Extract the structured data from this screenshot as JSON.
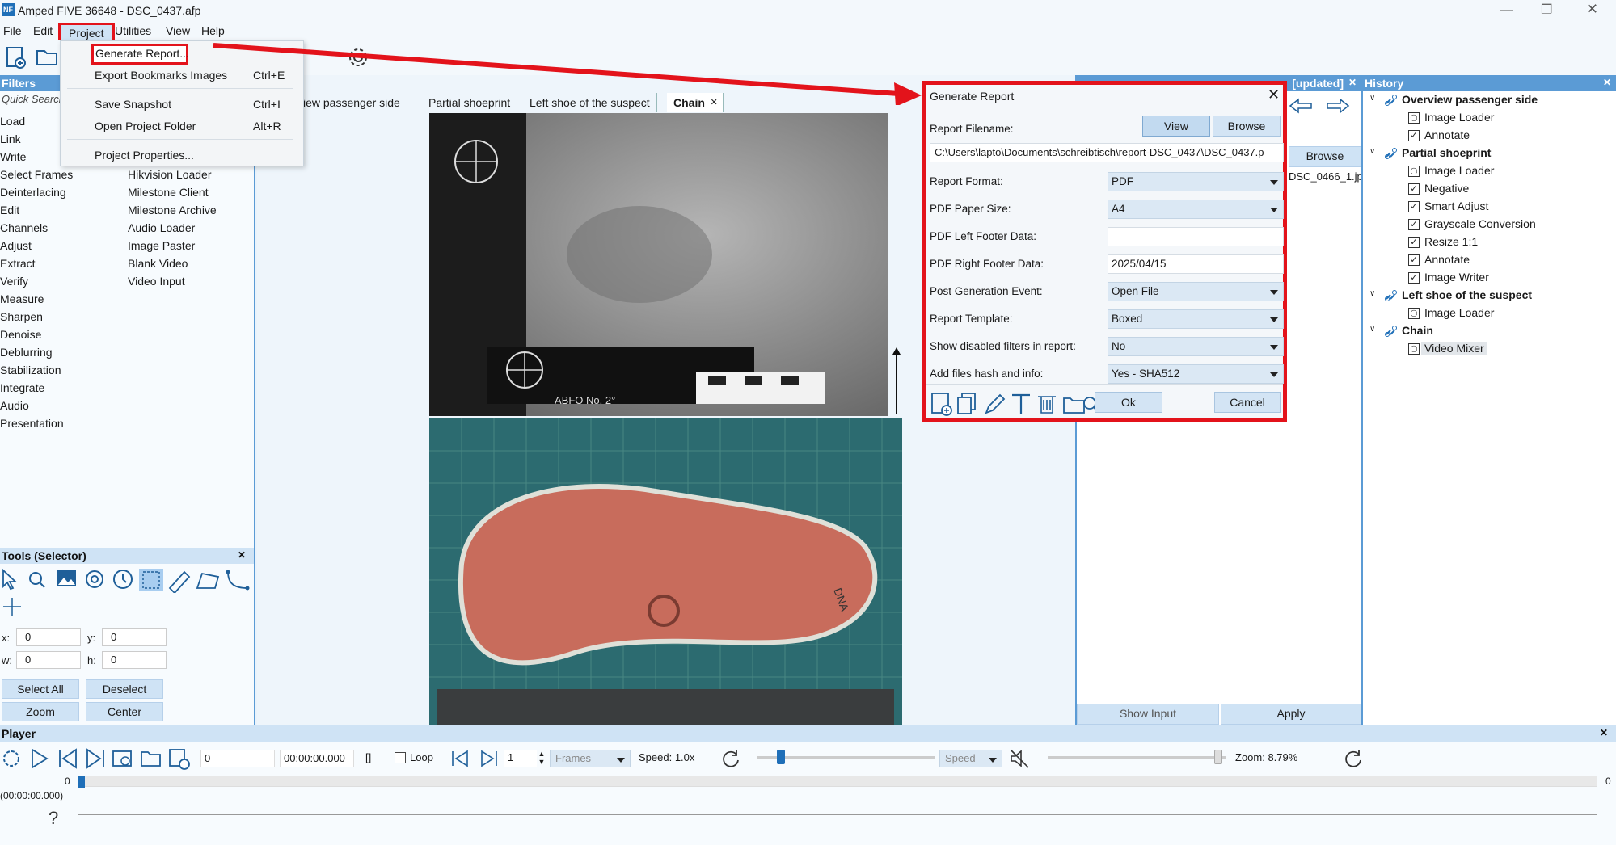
{
  "app": {
    "title": "Amped FIVE 36648 - DSC_0437.afp",
    "logo": "NF"
  },
  "menu": [
    "File",
    "Edit",
    "Project",
    "Utilities",
    "View",
    "Help"
  ],
  "project_menu": {
    "items": [
      {
        "label": "Generate Report...",
        "shortcut": ""
      },
      {
        "label": "Export Bookmarks Images",
        "shortcut": "Ctrl+E"
      },
      {
        "label": "Save Snapshot",
        "shortcut": "Ctrl+I"
      },
      {
        "label": "Open Project Folder",
        "shortcut": "Alt+R"
      },
      {
        "label": "Project Properties...",
        "shortcut": ""
      }
    ]
  },
  "filters": {
    "title": "Filters",
    "quick_search": "Quick Search",
    "categories": [
      "Load",
      "Link",
      "Write",
      "Select Frames",
      "Deinterlacing",
      "Edit",
      "Channels",
      "Adjust",
      "Extract",
      "Verify",
      "Measure",
      "Sharpen",
      "Denoise",
      "Deblurring",
      "Stabilization",
      "Integrate",
      "Audio",
      "Presentation"
    ],
    "loaders": [
      "Hikvision Loader",
      "Milestone Client",
      "Milestone Archive",
      "Audio Loader",
      "Image Paster",
      "Blank Video",
      "Video Input"
    ]
  },
  "tools": {
    "title": "Tools (Selector)",
    "x_label": "x:",
    "x": "0",
    "y_label": "y:",
    "y": "0",
    "w_label": "w:",
    "w": "0",
    "h_label": "h:",
    "h": "0",
    "select_all": "Select All",
    "deselect": "Deselect",
    "zoom": "Zoom",
    "center": "Center"
  },
  "tabs": [
    "view passenger side",
    "Partial shoeprint",
    "Left shoe of the suspect",
    "Chain"
  ],
  "right_panel": {
    "header": "[updated]",
    "browse": "Browse",
    "file": "DSC_0466_1.jp",
    "show_input": "Show Input",
    "apply": "Apply"
  },
  "history": {
    "title": "History",
    "groups": [
      {
        "name": "Overview passenger side",
        "items": [
          {
            "label": "Image Loader",
            "checked": false
          },
          {
            "label": "Annotate",
            "checked": true
          }
        ]
      },
      {
        "name": "Partial shoeprint",
        "items": [
          {
            "label": "Image Loader",
            "checked": false
          },
          {
            "label": "Negative",
            "checked": true
          },
          {
            "label": "Smart Adjust",
            "checked": true
          },
          {
            "label": "Grayscale Conversion",
            "checked": true
          },
          {
            "label": "Resize 1:1",
            "checked": true
          },
          {
            "label": "Annotate",
            "checked": true
          },
          {
            "label": "Image Writer",
            "checked": true
          }
        ]
      },
      {
        "name": "Left shoe of the suspect",
        "items": [
          {
            "label": "Image Loader",
            "checked": false
          }
        ]
      },
      {
        "name": "Chain",
        "items": [
          {
            "label": "Video Mixer",
            "checked": false
          }
        ]
      }
    ]
  },
  "dialog": {
    "title": "Generate Report",
    "filename_label": "Report Filename:",
    "view": "View",
    "browse": "Browse",
    "path": "C:\\Users\\lapto\\Documents\\schreibtisch\\report-DSC_0437\\DSC_0437.p",
    "rows": [
      {
        "label": "Report Format:",
        "value": "PDF",
        "select": true
      },
      {
        "label": "PDF Paper Size:",
        "value": "A4",
        "select": true
      },
      {
        "label": "PDF Left Footer Data:",
        "value": "",
        "select": false
      },
      {
        "label": "PDF Right Footer Data:",
        "value": "2025/04/15",
        "select": false
      },
      {
        "label": "Post Generation Event:",
        "value": "Open File",
        "select": true
      },
      {
        "label": "Report Template:",
        "value": "Boxed",
        "select": true
      },
      {
        "label": "Show disabled filters in report:",
        "value": "No",
        "select": true
      },
      {
        "label": "Add files hash and info:",
        "value": "Yes - SHA512",
        "select": true
      }
    ],
    "ok": "Ok",
    "cancel": "Cancel"
  },
  "player": {
    "title": "Player",
    "frame": "0",
    "time": "00:00:00.000",
    "brackets": "[]",
    "loop": "Loop",
    "step": "1",
    "frames": "Frames",
    "speed_label": "Speed: 1.0x",
    "speed": "Speed",
    "zoom": "Zoom: 8.79%",
    "timeline_start": "0",
    "timeline_end": "0",
    "time_display": "(00:00:00.000)",
    "help": "?",
    "speed_slider_level": 0.12,
    "zoom_slider_level": 0.98
  },
  "image_labels": {
    "abfo": "ABFO No. 2°",
    "brand": "DNA"
  },
  "colors": {
    "accent": "#5b9bd5",
    "highlight_red": "#e3131b"
  }
}
